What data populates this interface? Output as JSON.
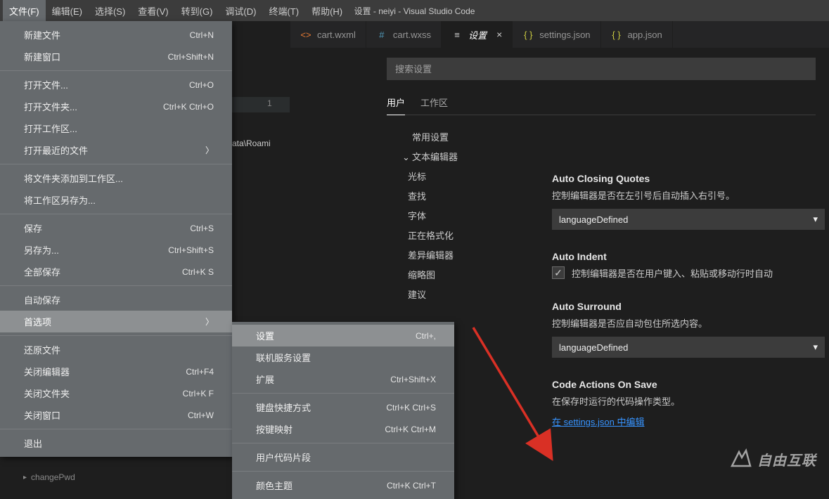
{
  "title": "设置 - neiyi - Visual Studio Code",
  "menubar": [
    "文件(F)",
    "编辑(E)",
    "选择(S)",
    "查看(V)",
    "转到(G)",
    "调试(D)",
    "终端(T)",
    "帮助(H)"
  ],
  "tabs": [
    {
      "icon": "<>",
      "cls": "fi-orange",
      "label": "cart.wxml"
    },
    {
      "icon": "#",
      "cls": "fi-blue",
      "label": "cart.wxss"
    },
    {
      "icon": "≡",
      "cls": "fi-gear",
      "label": "设置",
      "active": true,
      "close": "×"
    },
    {
      "icon": "{ }",
      "cls": "fi-json",
      "label": "settings.json"
    },
    {
      "icon": "{ }",
      "cls": "fi-json",
      "label": "app.json"
    }
  ],
  "search_placeholder": "搜索设置",
  "scope": [
    "用户",
    "工作区"
  ],
  "toc": [
    {
      "label": "常用设置"
    },
    {
      "label": "文本编辑器",
      "exp": true
    },
    {
      "label": "光标",
      "child": true
    },
    {
      "label": "查找",
      "child": true
    },
    {
      "label": "字体",
      "child": true
    },
    {
      "label": "正在格式化",
      "child": true
    },
    {
      "label": "差异编辑器",
      "child": true
    },
    {
      "label": "缩略图",
      "child": true
    },
    {
      "label": "建议",
      "child": true
    }
  ],
  "settings": {
    "s1": {
      "title": "Auto Closing Quotes",
      "desc": "控制编辑器是否在左引号后自动插入右引号。",
      "value": "languageDefined"
    },
    "s2": {
      "title": "Auto Indent",
      "desc": "控制编辑器是否在用户键入、粘贴或移动行时自动"
    },
    "s3": {
      "title": "Auto Surround",
      "desc": "控制编辑器是否应自动包住所选内容。",
      "value": "languageDefined"
    },
    "s4": {
      "title": "Code Actions On Save",
      "desc": "在保存时运行的代码操作类型。",
      "link": "在 settings.json 中编辑"
    }
  },
  "file_menu": [
    {
      "l": "新建文件",
      "k": "Ctrl+N"
    },
    {
      "l": "新建窗口",
      "k": "Ctrl+Shift+N"
    },
    {
      "sep": true
    },
    {
      "l": "打开文件...",
      "k": "Ctrl+O"
    },
    {
      "l": "打开文件夹...",
      "k": "Ctrl+K Ctrl+O"
    },
    {
      "l": "打开工作区..."
    },
    {
      "l": "打开最近的文件",
      "sub": true
    },
    {
      "sep": true
    },
    {
      "l": "将文件夹添加到工作区..."
    },
    {
      "l": "将工作区另存为..."
    },
    {
      "sep": true
    },
    {
      "l": "保存",
      "k": "Ctrl+S"
    },
    {
      "l": "另存为...",
      "k": "Ctrl+Shift+S"
    },
    {
      "l": "全部保存",
      "k": "Ctrl+K S"
    },
    {
      "sep": true
    },
    {
      "l": "自动保存"
    },
    {
      "l": "首选项",
      "sub": true,
      "hover": true
    },
    {
      "sep": true
    },
    {
      "l": "还原文件"
    },
    {
      "l": "关闭编辑器",
      "k": "Ctrl+F4"
    },
    {
      "l": "关闭文件夹",
      "k": "Ctrl+K F"
    },
    {
      "l": "关闭窗口",
      "k": "Ctrl+W"
    },
    {
      "sep": true
    },
    {
      "l": "退出"
    }
  ],
  "submenu": [
    {
      "l": "设置",
      "k": "Ctrl+,",
      "hover": true
    },
    {
      "l": "联机服务设置"
    },
    {
      "l": "扩展",
      "k": "Ctrl+Shift+X"
    },
    {
      "sep": true
    },
    {
      "l": "键盘快捷方式",
      "k": "Ctrl+K Ctrl+S"
    },
    {
      "l": "按键映射",
      "k": "Ctrl+K Ctrl+M"
    },
    {
      "sep": true
    },
    {
      "l": "用户代码片段"
    },
    {
      "sep": true
    },
    {
      "l": "颜色主题",
      "k": "Ctrl+K Ctrl+T"
    }
  ],
  "gutter": "1",
  "path_fragment": "ata\\Roami",
  "explorer_item": "changePwd",
  "watermark": "自由互联"
}
